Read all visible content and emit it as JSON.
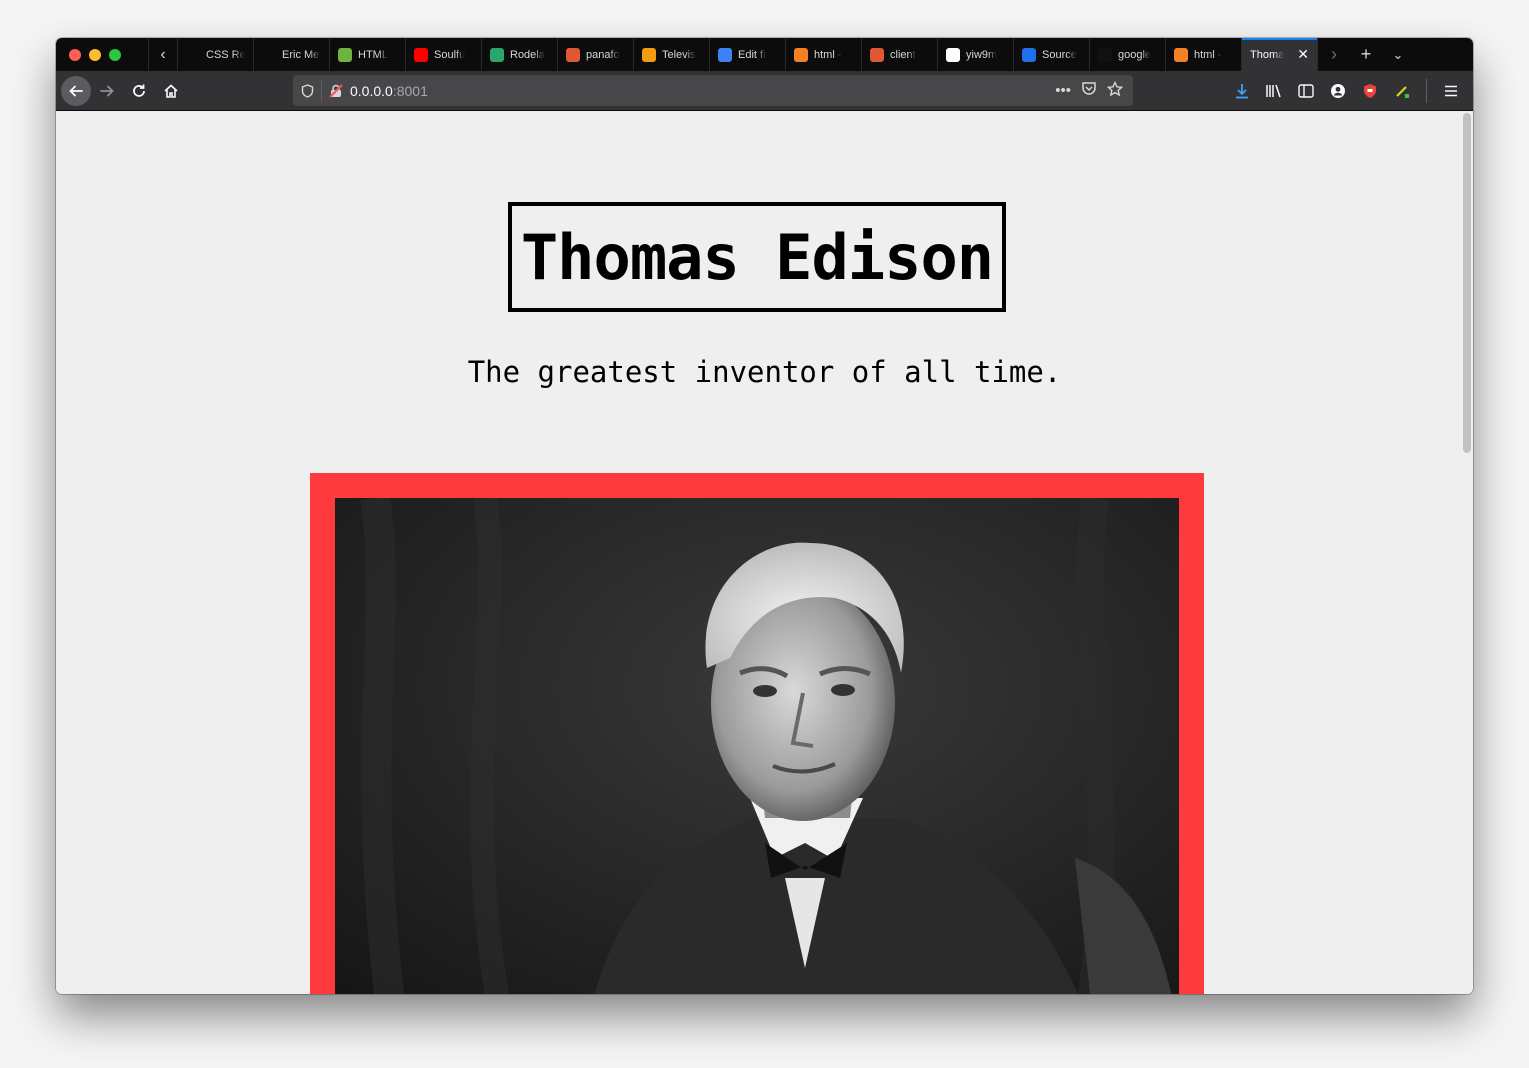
{
  "browser": {
    "tabs": [
      {
        "label": "CSS Reset",
        "favicon": "blank-page-icon",
        "color": "#0c0c0d"
      },
      {
        "label": "Eric Meyer",
        "favicon": "blank-page-icon",
        "color": "#0c0c0d"
      },
      {
        "label": "HTML",
        "favicon": "w3-validator-icon",
        "color": "#6eb33f"
      },
      {
        "label": "Soulfu",
        "favicon": "youtube-icon",
        "color": "#ff0000"
      },
      {
        "label": "Rodela",
        "favicon": "globe-icon",
        "color": "#2aa56b"
      },
      {
        "label": "panafo",
        "favicon": "duckduckgo-icon",
        "color": "#de5833"
      },
      {
        "label": "Televis",
        "favicon": "archive-icon",
        "color": "#f39c12"
      },
      {
        "label": "Edit fi",
        "favicon": "cloud-icon",
        "color": "#3b82f6"
      },
      {
        "label": "html -",
        "favicon": "stackoverflow-icon",
        "color": "#f48024"
      },
      {
        "label": "client",
        "favicon": "duckduckgo-icon",
        "color": "#de5833"
      },
      {
        "label": "yiw9m",
        "favicon": "info-icon",
        "color": "#ffffff"
      },
      {
        "label": "Source",
        "favicon": "f-icon",
        "color": "#1f6feb"
      },
      {
        "label": "google",
        "favicon": "github-icon",
        "color": "#111111"
      },
      {
        "label": "html -",
        "favicon": "stackoverflow-icon",
        "color": "#f48024"
      },
      {
        "label": "Thoma",
        "favicon": "none",
        "color": "#323234",
        "active": true
      }
    ],
    "url_host": "0.0.0.0",
    "url_port": ":8001"
  },
  "page": {
    "title": "Thomas Edison",
    "tagline": "The greatest inventor of all time.",
    "accent_color": "#fe3a3e",
    "photo_description_icon": "portrait-photo"
  }
}
